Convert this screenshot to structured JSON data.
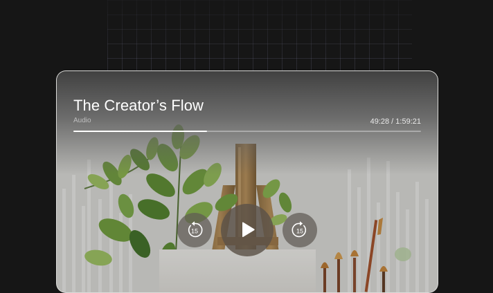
{
  "player": {
    "title": "The Creator’s Flow",
    "media_type": "Audio",
    "time_readout": "49:28 / 1:59:21",
    "progress": 0.385,
    "controls": {
      "skip_back_icon": "rewind-15-icon",
      "skip_back_seconds": "15",
      "play_icon": "play-icon",
      "skip_forward_icon": "forward-15-icon",
      "skip_forward_seconds": "15"
    }
  },
  "colors": {
    "page_background": "#161616",
    "progress_fill": "#ffffff",
    "control_background": "#5c5248"
  }
}
